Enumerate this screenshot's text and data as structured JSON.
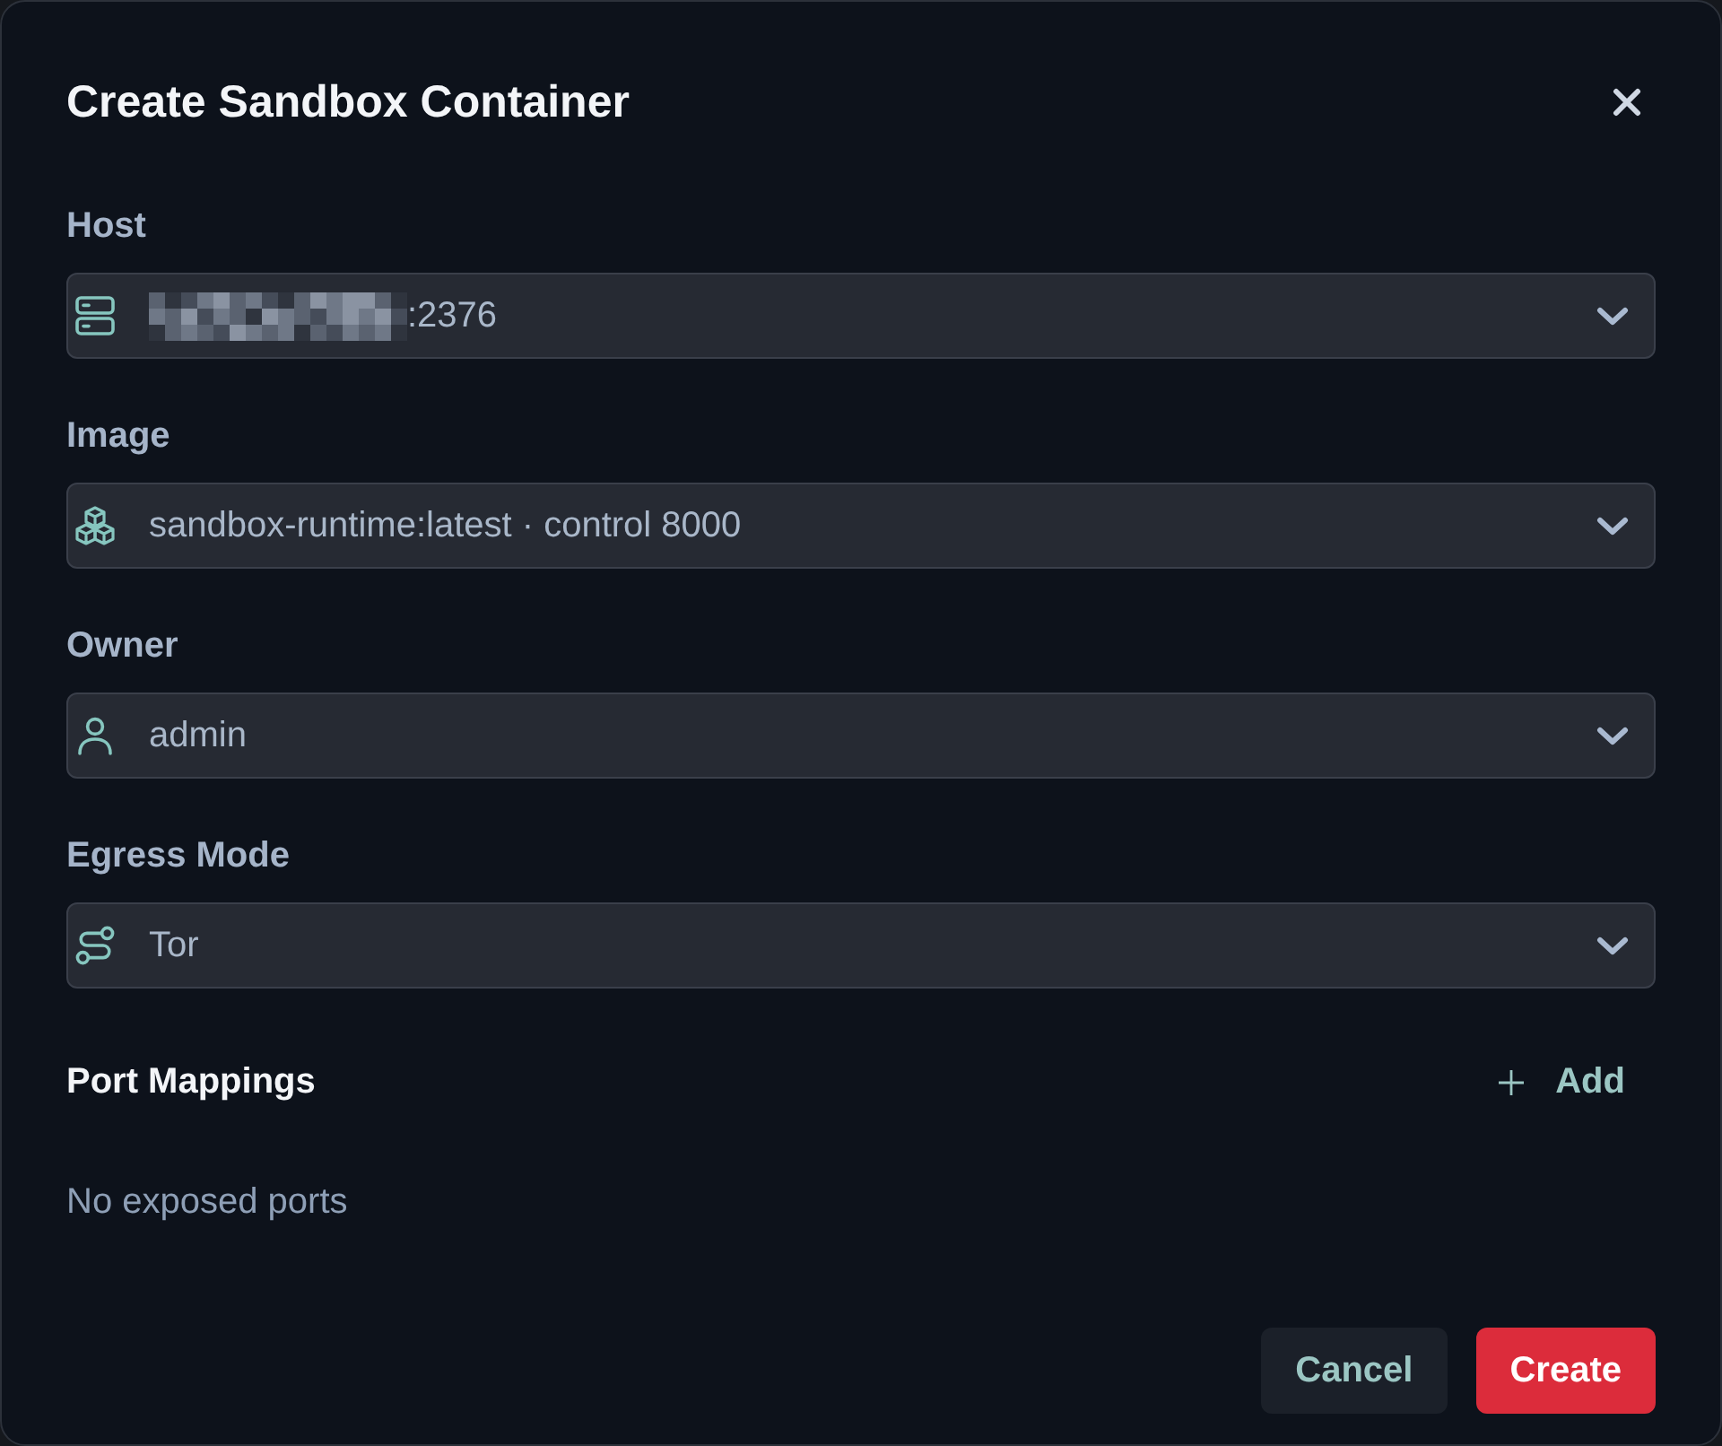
{
  "dialog": {
    "title": "Create Sandbox Container"
  },
  "fields": [
    {
      "label": "Host",
      "value": ":2376",
      "redacted": true
    },
    {
      "label": "Image",
      "value": "sandbox-runtime:latest · control 8000",
      "redacted": false
    },
    {
      "label": "Owner",
      "value": "admin",
      "redacted": false
    },
    {
      "label": "Egress Mode",
      "value": "Tor",
      "redacted": false
    }
  ],
  "port_mappings": {
    "title": "Port Mappings",
    "add_button": "Add",
    "empty_text": "No exposed ports"
  },
  "buttons": [
    {
      "label": "Cancel",
      "kind": "secondary"
    },
    {
      "label": "Create",
      "kind": "primary"
    }
  ]
}
